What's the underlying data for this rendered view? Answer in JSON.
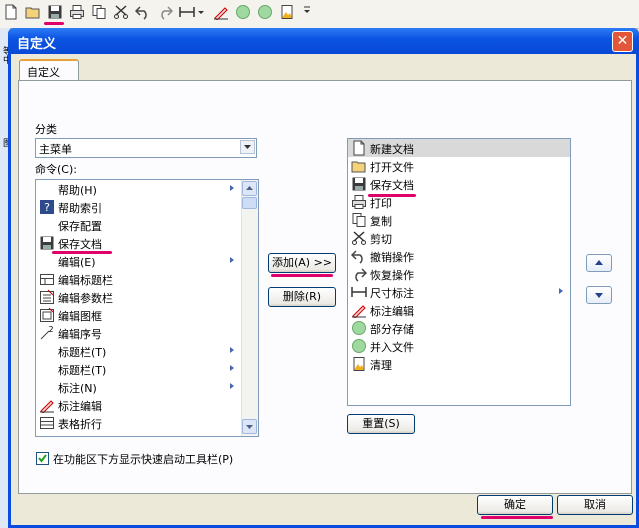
{
  "window": {
    "title": "自定义",
    "close_symbol": "✕"
  },
  "tab_label": "自定义",
  "left_strip": {
    "top_text": "等中",
    "bottom_text": "图"
  },
  "category": {
    "label": "分类",
    "selected": "主菜单"
  },
  "commands_label": "命令(C):",
  "commands": [
    {
      "label": "帮助(H)",
      "icon": "",
      "submenu": true
    },
    {
      "label": "帮助索引",
      "icon": "help-index-icon",
      "submenu": false
    },
    {
      "label": "保存配置",
      "icon": "",
      "submenu": false
    },
    {
      "label": "保存文档",
      "icon": "save-icon",
      "submenu": false
    },
    {
      "label": "编辑(E)",
      "icon": "",
      "submenu": true
    },
    {
      "label": "编辑标题栏",
      "icon": "edit-titlebar-icon",
      "submenu": false
    },
    {
      "label": "编辑参数栏",
      "icon": "edit-param-icon",
      "submenu": false
    },
    {
      "label": "编辑图框",
      "icon": "edit-frame-icon",
      "submenu": false
    },
    {
      "label": "编辑序号",
      "icon": "edit-seq-icon",
      "submenu": false
    },
    {
      "label": "标题栏(T)",
      "icon": "",
      "submenu": true
    },
    {
      "label": "标题栏(T)",
      "icon": "",
      "submenu": true
    },
    {
      "label": "标注(N)",
      "icon": "",
      "submenu": true
    },
    {
      "label": "标注编辑",
      "icon": "dim-edit-icon",
      "submenu": false
    },
    {
      "label": "表格折行",
      "icon": "table-wrap-icon",
      "submenu": false
    }
  ],
  "toolbar_items": [
    {
      "label": "新建文档",
      "icon": "new-doc-icon",
      "submenu": false
    },
    {
      "label": "打开文件",
      "icon": "open-folder-icon",
      "submenu": false
    },
    {
      "label": "保存文档",
      "icon": "save-icon",
      "submenu": false
    },
    {
      "label": "打印",
      "icon": "print-icon",
      "submenu": false
    },
    {
      "label": "复制",
      "icon": "copy-icon",
      "submenu": false
    },
    {
      "label": "剪切",
      "icon": "scissors-icon",
      "submenu": false
    },
    {
      "label": "撤销操作",
      "icon": "undo-icon",
      "submenu": false
    },
    {
      "label": "恢复操作",
      "icon": "redo-icon",
      "submenu": false
    },
    {
      "label": "尺寸标注",
      "icon": "dimension-icon",
      "submenu": true
    },
    {
      "label": "标注编辑",
      "icon": "dim-edit-icon",
      "submenu": false
    },
    {
      "label": "部分存储",
      "icon": "green-circle-icon",
      "submenu": false
    },
    {
      "label": "并入文件",
      "icon": "green-circle-icon",
      "submenu": false
    },
    {
      "label": "清理",
      "icon": "clean-icon",
      "submenu": false
    }
  ],
  "buttons": {
    "add": "添加(A) >>",
    "remove": "删除(R)",
    "reset": "重置(S)",
    "ok": "确定",
    "cancel": "取消"
  },
  "checkbox": {
    "label": "在功能区下方显示快速启动工具栏(P)",
    "checked": true
  },
  "accent_color": "#e0006a"
}
